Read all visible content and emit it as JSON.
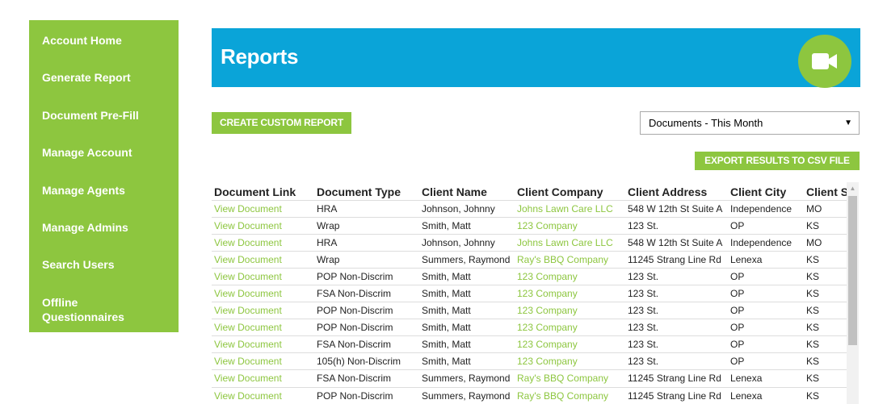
{
  "sidebar": {
    "items": [
      {
        "label": "Account Home"
      },
      {
        "label": "Generate Report"
      },
      {
        "label": "Document Pre-Fill"
      },
      {
        "label": "Manage Account"
      },
      {
        "label": "Manage Agents"
      },
      {
        "label": "Manage Admins"
      },
      {
        "label": "Search Users"
      },
      {
        "label": "Offline Questionnaires"
      }
    ]
  },
  "header": {
    "title": "Reports",
    "video_icon": "video-camera-icon"
  },
  "toolbar": {
    "create_label": "CREATE CUSTOM REPORT",
    "export_label": "EXPORT RESULTS TO CSV FILE",
    "filter_selected": "Documents - This Month"
  },
  "colors": {
    "accent_green": "#8dc63f",
    "header_blue": "#0aa4d8"
  },
  "table": {
    "columns": [
      "Document Link",
      "Document Type",
      "Client Name",
      "Client Company",
      "Client Address",
      "Client City",
      "Client S"
    ],
    "rows": [
      [
        "View Document",
        "HRA",
        "Johnson, Johnny",
        "Johns Lawn Care LLC",
        "548 W 12th St Suite A",
        "Independence",
        "MO"
      ],
      [
        "View Document",
        "Wrap",
        "Smith, Matt",
        "123 Company",
        "123 St.",
        "OP",
        "KS"
      ],
      [
        "View Document",
        "HRA",
        "Johnson, Johnny",
        "Johns Lawn Care LLC",
        "548 W 12th St Suite A",
        "Independence",
        "MO"
      ],
      [
        "View Document",
        "Wrap",
        "Summers, Raymond",
        "Ray's BBQ Company",
        "11245 Strang Line Rd",
        "Lenexa",
        "KS"
      ],
      [
        "View Document",
        "POP Non-Discrim",
        "Smith, Matt",
        "123 Company",
        "123 St.",
        "OP",
        "KS"
      ],
      [
        "View Document",
        "FSA Non-Discrim",
        "Smith, Matt",
        "123 Company",
        "123 St.",
        "OP",
        "KS"
      ],
      [
        "View Document",
        "POP Non-Discrim",
        "Smith, Matt",
        "123 Company",
        "123 St.",
        "OP",
        "KS"
      ],
      [
        "View Document",
        "POP Non-Discrim",
        "Smith, Matt",
        "123 Company",
        "123 St.",
        "OP",
        "KS"
      ],
      [
        "View Document",
        "FSA Non-Discrim",
        "Smith, Matt",
        "123 Company",
        "123 St.",
        "OP",
        "KS"
      ],
      [
        "View Document",
        "105(h) Non-Discrim",
        "Smith, Matt",
        "123 Company",
        "123 St.",
        "OP",
        "KS"
      ],
      [
        "View Document",
        "FSA Non-Discrim",
        "Summers, Raymond",
        "Ray's BBQ Company",
        "11245 Strang Line Rd",
        "Lenexa",
        "KS"
      ],
      [
        "View Document",
        "POP Non-Discrim",
        "Summers, Raymond",
        "Ray's BBQ Company",
        "11245 Strang Line Rd",
        "Lenexa",
        "KS"
      ]
    ]
  }
}
